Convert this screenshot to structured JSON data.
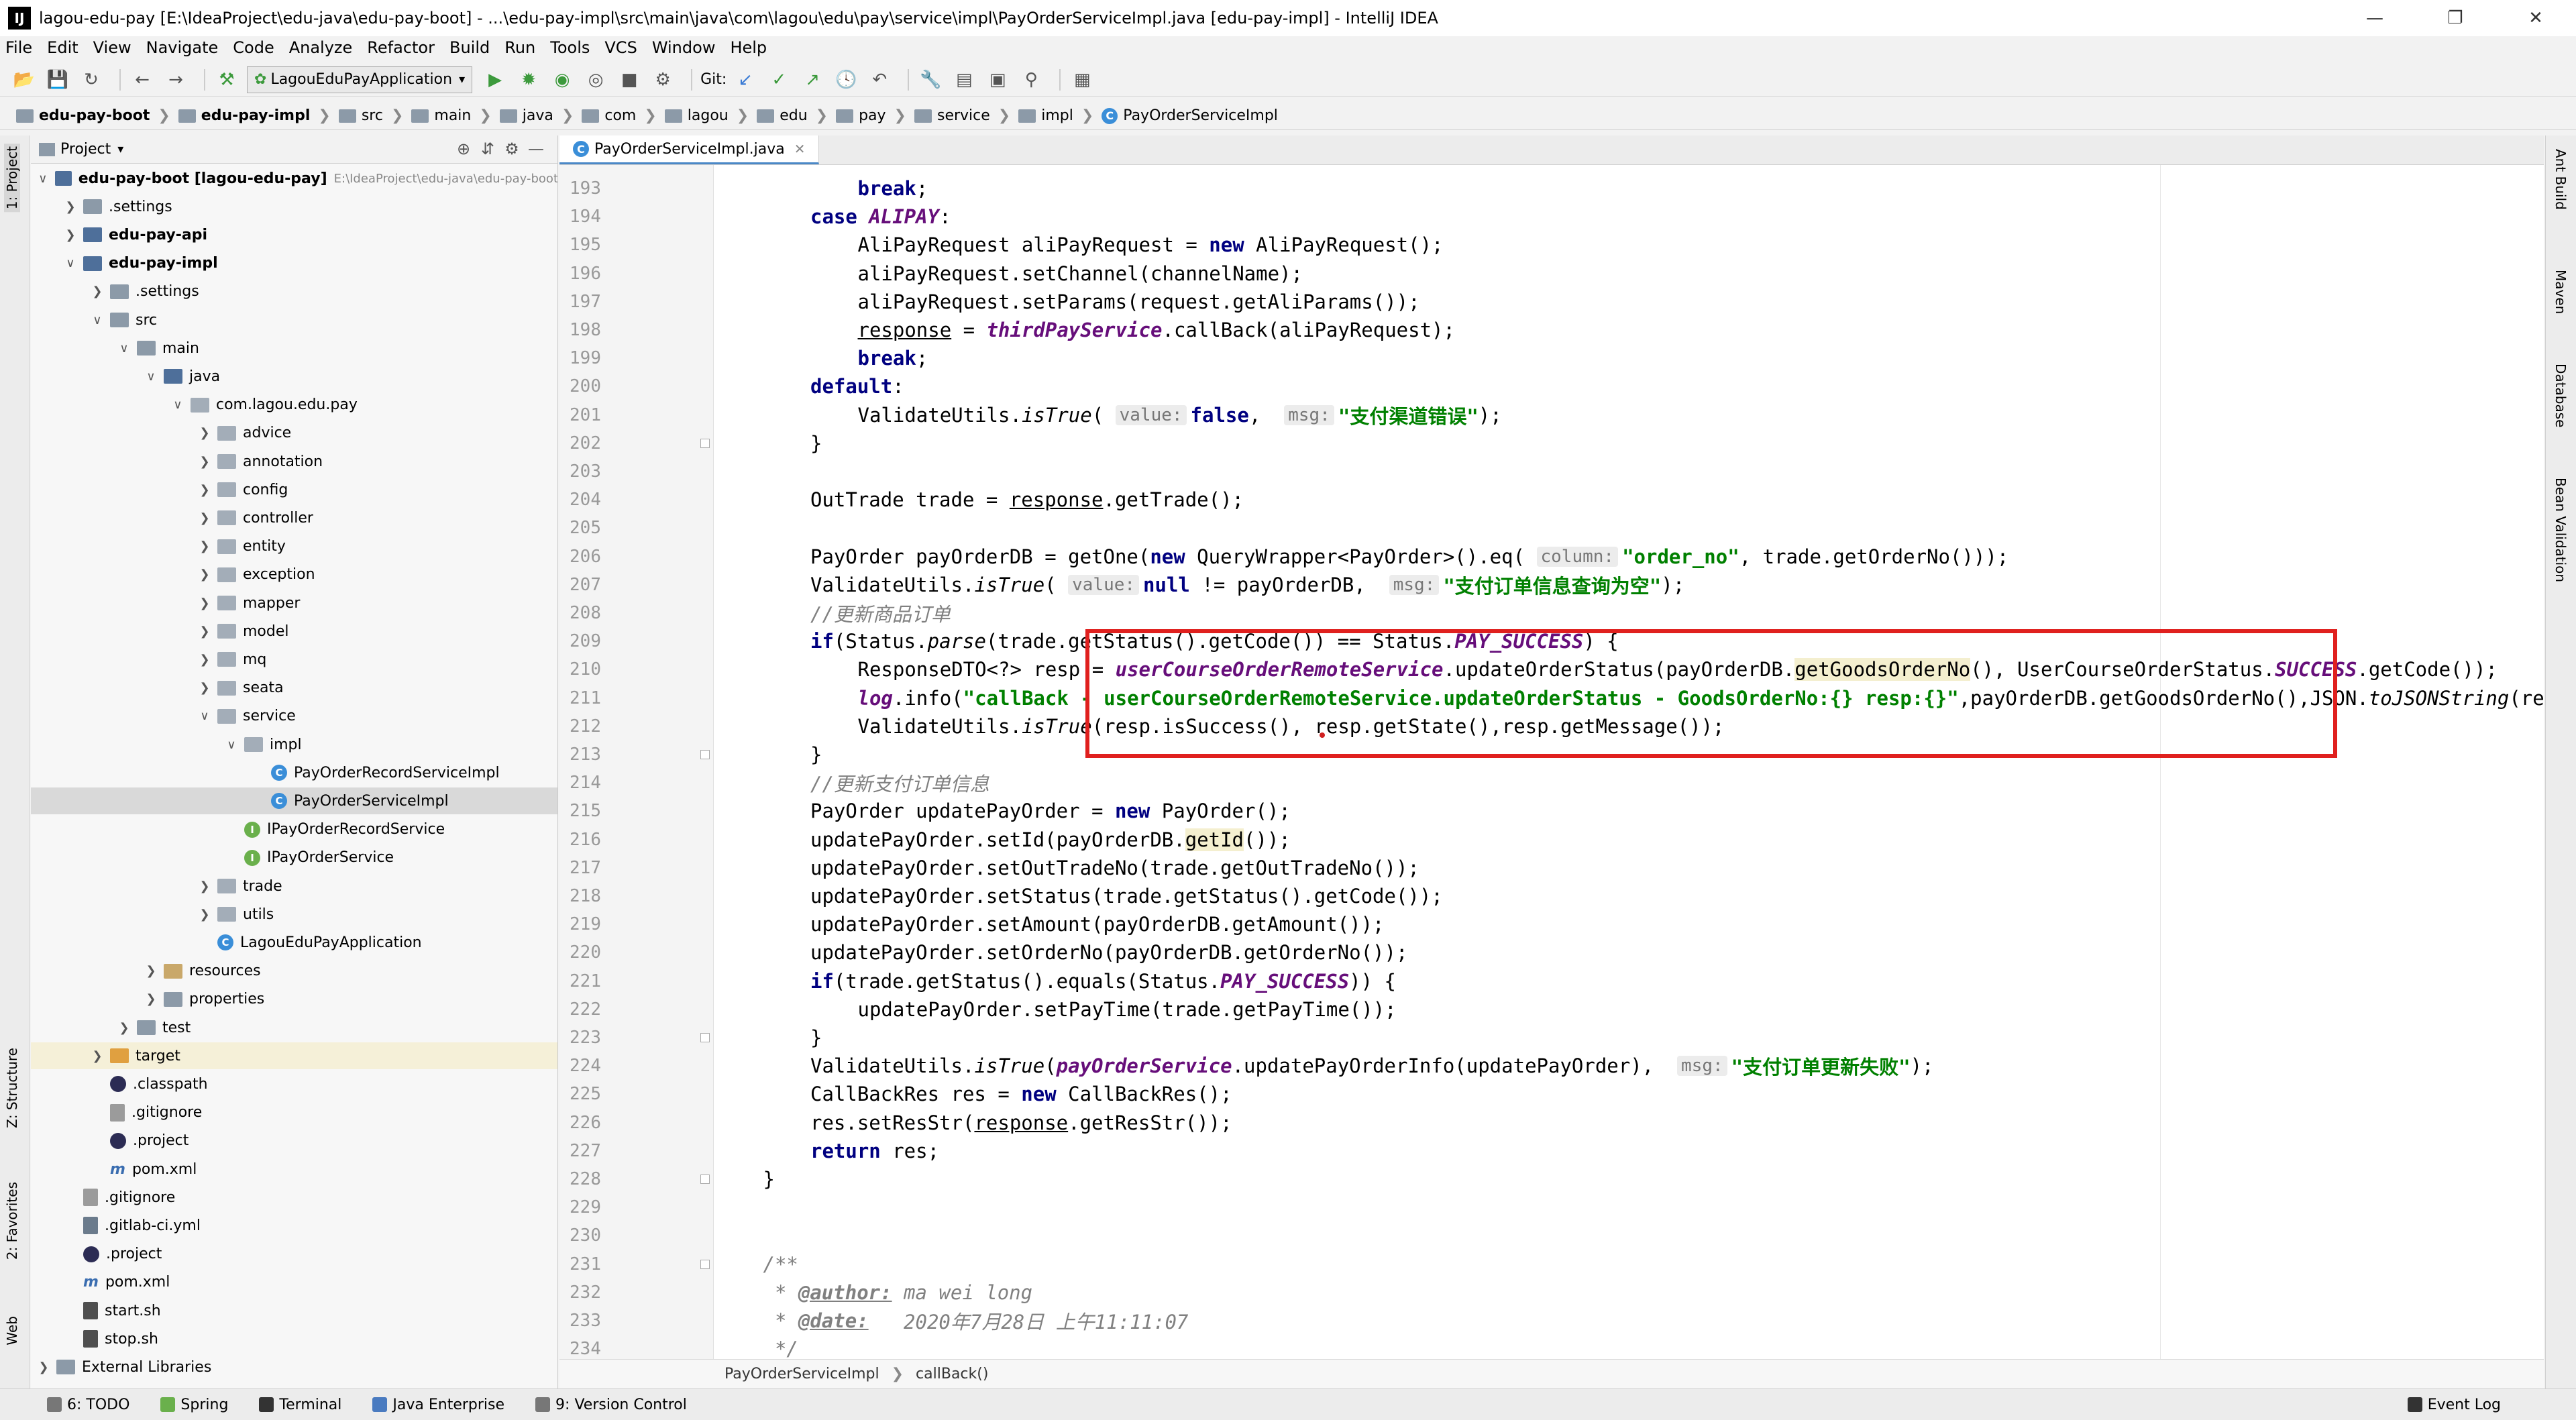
{
  "window": {
    "title": "lagou-edu-pay [E:\\IdeaProject\\edu-java\\edu-pay-boot] - ...\\edu-pay-impl\\src\\main\\java\\com\\lagou\\edu\\pay\\service\\impl\\PayOrderServiceImpl.java [edu-pay-impl] - IntelliJ IDEA",
    "logo": "IJ"
  },
  "menu": [
    "File",
    "Edit",
    "View",
    "Navigate",
    "Code",
    "Analyze",
    "Refactor",
    "Build",
    "Run",
    "Tools",
    "VCS",
    "Window",
    "Help"
  ],
  "toolbar": {
    "run_config": "LagouEduPayApplication",
    "git_label": "Git:"
  },
  "breadcrumb": [
    "edu-pay-boot",
    "edu-pay-impl",
    "src",
    "main",
    "java",
    "com",
    "lagou",
    "edu",
    "pay",
    "service",
    "impl",
    "PayOrderServiceImpl"
  ],
  "left_tool_tabs": [
    "1: Project",
    "Z: Structure",
    "2: Favorites",
    "Web"
  ],
  "right_tool_tabs": [
    "Ant Build",
    "Maven",
    "Database",
    "Bean Validation"
  ],
  "project_panel": {
    "title": "Project",
    "tree": [
      {
        "label": "edu-pay-boot [lagou-edu-pay]",
        "hint": "E:\\IdeaProject\\edu-java\\edu-pay-boot",
        "depth": 0,
        "icon": "module-folder",
        "open": true,
        "bold": true
      },
      {
        "label": ".settings",
        "depth": 1,
        "icon": "folder",
        "open": false
      },
      {
        "label": "edu-pay-api",
        "depth": 1,
        "icon": "module-folder",
        "open": false,
        "bold": true
      },
      {
        "label": "edu-pay-impl",
        "depth": 1,
        "icon": "module-folder",
        "open": true,
        "bold": true
      },
      {
        "label": ".settings",
        "depth": 2,
        "icon": "folder",
        "open": false
      },
      {
        "label": "src",
        "depth": 2,
        "icon": "folder",
        "open": true
      },
      {
        "label": "main",
        "depth": 3,
        "icon": "folder",
        "open": true
      },
      {
        "label": "java",
        "depth": 4,
        "icon": "source-folder",
        "open": true
      },
      {
        "label": "com.lagou.edu.pay",
        "depth": 5,
        "icon": "package",
        "open": true
      },
      {
        "label": "advice",
        "depth": 6,
        "icon": "package",
        "open": false
      },
      {
        "label": "annotation",
        "depth": 6,
        "icon": "package",
        "open": false
      },
      {
        "label": "config",
        "depth": 6,
        "icon": "package",
        "open": false
      },
      {
        "label": "controller",
        "depth": 6,
        "icon": "package",
        "open": false
      },
      {
        "label": "entity",
        "depth": 6,
        "icon": "package",
        "open": false
      },
      {
        "label": "exception",
        "depth": 6,
        "icon": "package",
        "open": false
      },
      {
        "label": "mapper",
        "depth": 6,
        "icon": "package",
        "open": false
      },
      {
        "label": "model",
        "depth": 6,
        "icon": "package",
        "open": false
      },
      {
        "label": "mq",
        "depth": 6,
        "icon": "package",
        "open": false
      },
      {
        "label": "seata",
        "depth": 6,
        "icon": "package",
        "open": false
      },
      {
        "label": "service",
        "depth": 6,
        "icon": "package",
        "open": true
      },
      {
        "label": "impl",
        "depth": 7,
        "icon": "package",
        "open": true
      },
      {
        "label": "PayOrderRecordServiceImpl",
        "depth": 8,
        "icon": "class"
      },
      {
        "label": "PayOrderServiceImpl",
        "depth": 8,
        "icon": "class",
        "selected": true
      },
      {
        "label": "IPayOrderRecordService",
        "depth": 7,
        "icon": "interface"
      },
      {
        "label": "IPayOrderService",
        "depth": 7,
        "icon": "interface"
      },
      {
        "label": "trade",
        "depth": 6,
        "icon": "package",
        "open": false
      },
      {
        "label": "utils",
        "depth": 6,
        "icon": "package",
        "open": false
      },
      {
        "label": "LagouEduPayApplication",
        "depth": 6,
        "icon": "app-class"
      },
      {
        "label": "resources",
        "depth": 4,
        "icon": "resources-folder",
        "open": false
      },
      {
        "label": "properties",
        "depth": 4,
        "icon": "folder",
        "open": false
      },
      {
        "label": "test",
        "depth": 3,
        "icon": "folder",
        "open": false
      },
      {
        "label": "target",
        "depth": 2,
        "icon": "target-folder",
        "open": false,
        "highlighted": true
      },
      {
        "label": ".classpath",
        "depth": 2,
        "icon": "eclipse-file"
      },
      {
        "label": ".gitignore",
        "depth": 2,
        "icon": "git-file"
      },
      {
        "label": ".project",
        "depth": 2,
        "icon": "eclipse-file"
      },
      {
        "label": "pom.xml",
        "depth": 2,
        "icon": "maven-file"
      },
      {
        "label": ".gitignore",
        "depth": 1,
        "icon": "git-file"
      },
      {
        "label": ".gitlab-ci.yml",
        "depth": 1,
        "icon": "yml-file"
      },
      {
        "label": ".project",
        "depth": 1,
        "icon": "eclipse-file"
      },
      {
        "label": "pom.xml",
        "depth": 1,
        "icon": "maven-file"
      },
      {
        "label": "start.sh",
        "depth": 1,
        "icon": "sh-file"
      },
      {
        "label": "stop.sh",
        "depth": 1,
        "icon": "sh-file"
      },
      {
        "label": "External Libraries",
        "depth": 0,
        "icon": "library",
        "open": false
      }
    ]
  },
  "editor": {
    "tab": "PayOrderServiceImpl.java",
    "breadcrumb": [
      "PayOrderServiceImpl",
      "callBack()"
    ],
    "lines": [
      {
        "n": "193",
        "indent": 5,
        "tokens": [
          [
            "kw",
            "break"
          ],
          [
            "",
            "; "
          ]
        ]
      },
      {
        "n": "194",
        "indent": 4,
        "tokens": [
          [
            "kw",
            "case "
          ],
          [
            "fld",
            "ALIPAY"
          ],
          [
            "",
            ":"
          ]
        ]
      },
      {
        "n": "195",
        "indent": 5,
        "tokens": [
          [
            "",
            "AliPayRequest aliPayRequest = "
          ],
          [
            "kw",
            "new "
          ],
          [
            "",
            "AliPayRequest();"
          ]
        ]
      },
      {
        "n": "196",
        "indent": 5,
        "tokens": [
          [
            "",
            "aliPayRequest.setChannel(channelName);"
          ]
        ]
      },
      {
        "n": "197",
        "indent": 5,
        "tokens": [
          [
            "",
            "aliPayRequest.setParams(request.getAliParams());"
          ]
        ]
      },
      {
        "n": "198",
        "indent": 5,
        "tokens": [
          [
            "ul",
            "response"
          ],
          [
            "",
            " = "
          ],
          [
            "fld",
            "thirdPayService"
          ],
          [
            "",
            ".callBack(aliPayRequest);"
          ]
        ]
      },
      {
        "n": "199",
        "indent": 5,
        "tokens": [
          [
            "kw",
            "break"
          ],
          [
            "",
            ";"
          ]
        ]
      },
      {
        "n": "200",
        "indent": 4,
        "tokens": [
          [
            "kw",
            "default"
          ],
          [
            "",
            ":"
          ]
        ]
      },
      {
        "n": "201",
        "indent": 5,
        "tokens": [
          [
            "",
            "ValidateUtils."
          ],
          [
            "stc",
            "isTrue"
          ],
          [
            "",
            "( "
          ],
          [
            "hint",
            "value:"
          ],
          [
            "kw",
            "false"
          ],
          [
            "",
            ",  "
          ],
          [
            "hint",
            "msg:"
          ],
          [
            "str",
            "\"支付渠道错误\""
          ],
          [
            "",
            ");"
          ]
        ]
      },
      {
        "n": "202",
        "indent": 4,
        "tokens": [
          [
            "",
            "}"
          ]
        ]
      },
      {
        "n": "203",
        "indent": 0,
        "tokens": []
      },
      {
        "n": "204",
        "indent": 4,
        "tokens": [
          [
            "",
            "OutTrade trade = "
          ],
          [
            "ul",
            "response"
          ],
          [
            "",
            ".getTrade();"
          ]
        ]
      },
      {
        "n": "205",
        "indent": 0,
        "tokens": []
      },
      {
        "n": "206",
        "indent": 4,
        "tokens": [
          [
            "",
            "PayOrder payOrderDB = getOne("
          ],
          [
            "kw",
            "new "
          ],
          [
            "",
            "QueryWrapper<PayOrder>().eq( "
          ],
          [
            "hint",
            "column:"
          ],
          [
            "str",
            "\"order_no\""
          ],
          [
            "",
            ", trade.getOrderNo()));"
          ]
        ]
      },
      {
        "n": "207",
        "indent": 4,
        "tokens": [
          [
            "",
            "ValidateUtils."
          ],
          [
            "stc",
            "isTrue"
          ],
          [
            "",
            "( "
          ],
          [
            "hint",
            "value:"
          ],
          [
            "kw",
            "null "
          ],
          [
            "",
            "!= payOrderDB,  "
          ],
          [
            "hint",
            "msg:"
          ],
          [
            "str",
            "\"支付订单信息查询为空\""
          ],
          [
            "",
            ");"
          ]
        ]
      },
      {
        "n": "208",
        "indent": 4,
        "tokens": [
          [
            "cmt",
            "//更新商品订单"
          ]
        ]
      },
      {
        "n": "209",
        "indent": 4,
        "tokens": [
          [
            "kw",
            "if"
          ],
          [
            "",
            "(Status."
          ],
          [
            "stc",
            "parse"
          ],
          [
            "",
            "(trade.getStatus().getCode()) == Status."
          ],
          [
            "fld",
            "PAY_SUCCESS"
          ],
          [
            "",
            ") {"
          ]
        ]
      },
      {
        "n": "210",
        "indent": 5,
        "tokens": [
          [
            "",
            "ResponseDTO<?> resp = "
          ],
          [
            "fld",
            "userCourseOrderRemoteService"
          ],
          [
            "",
            ".updateOrderStatus(payOrderDB."
          ],
          [
            "hl",
            "getGoodsOrderNo"
          ],
          [
            "",
            "(), UserCourseOrderStatus."
          ],
          [
            "fld",
            "SUCCESS"
          ],
          [
            "",
            ".getCode());"
          ]
        ]
      },
      {
        "n": "211",
        "indent": 5,
        "tokens": [
          [
            "fld",
            "log"
          ],
          [
            "",
            ".info("
          ],
          [
            "str",
            "\"callBack - userCourseOrderRemoteService.updateOrderStatus - GoodsOrderNo:{} resp:{}\""
          ],
          [
            "",
            ",payOrderDB.getGoodsOrderNo(),JSON."
          ],
          [
            "stc",
            "toJSONString"
          ],
          [
            "",
            "(resp));"
          ]
        ]
      },
      {
        "n": "212",
        "indent": 5,
        "tokens": [
          [
            "",
            "ValidateUtils."
          ],
          [
            "stc",
            "isTrue"
          ],
          [
            "",
            "(resp.isSuccess(), resp.getState(),resp.getMessage());"
          ]
        ]
      },
      {
        "n": "213",
        "indent": 4,
        "tokens": [
          [
            "",
            "}"
          ]
        ]
      },
      {
        "n": "214",
        "indent": 4,
        "tokens": [
          [
            "cmt",
            "//更新支付订单信息"
          ]
        ]
      },
      {
        "n": "215",
        "indent": 4,
        "tokens": [
          [
            "",
            "PayOrder updatePayOrder = "
          ],
          [
            "kw",
            "new "
          ],
          [
            "",
            "PayOrder();"
          ]
        ]
      },
      {
        "n": "216",
        "indent": 4,
        "tokens": [
          [
            "",
            "updatePayOrder.setId(payOrderDB."
          ],
          [
            "hl",
            "getId"
          ],
          [
            "",
            "());"
          ]
        ]
      },
      {
        "n": "217",
        "indent": 4,
        "tokens": [
          [
            "",
            "updatePayOrder.setOutTradeNo(trade.getOutTradeNo());"
          ]
        ]
      },
      {
        "n": "218",
        "indent": 4,
        "tokens": [
          [
            "",
            "updatePayOrder.setStatus(trade.getStatus().getCode());"
          ]
        ]
      },
      {
        "n": "219",
        "indent": 4,
        "tokens": [
          [
            "",
            "updatePayOrder.setAmount(payOrderDB.getAmount());"
          ]
        ]
      },
      {
        "n": "220",
        "indent": 4,
        "tokens": [
          [
            "",
            "updatePayOrder.setOrderNo(payOrderDB.getOrderNo());"
          ]
        ]
      },
      {
        "n": "221",
        "indent": 4,
        "tokens": [
          [
            "kw",
            "if"
          ],
          [
            "",
            "(trade.getStatus().equals(Status."
          ],
          [
            "fld",
            "PAY_SUCCESS"
          ],
          [
            "",
            ")) {"
          ]
        ]
      },
      {
        "n": "222",
        "indent": 5,
        "tokens": [
          [
            "",
            "updatePayOrder.setPayTime(trade.getPayTime());"
          ]
        ]
      },
      {
        "n": "223",
        "indent": 4,
        "tokens": [
          [
            "",
            "}"
          ]
        ]
      },
      {
        "n": "224",
        "indent": 4,
        "tokens": [
          [
            "",
            "ValidateUtils."
          ],
          [
            "stc",
            "isTrue"
          ],
          [
            "",
            "("
          ],
          [
            "fld",
            "payOrderService"
          ],
          [
            "",
            ".updatePayOrderInfo(updatePayOrder),  "
          ],
          [
            "hint",
            "msg:"
          ],
          [
            "str",
            "\"支付订单更新失败\""
          ],
          [
            "",
            ");"
          ]
        ]
      },
      {
        "n": "225",
        "indent": 4,
        "tokens": [
          [
            "",
            "CallBackRes res = "
          ],
          [
            "kw",
            "new "
          ],
          [
            "",
            "CallBackRes();"
          ]
        ]
      },
      {
        "n": "226",
        "indent": 4,
        "tokens": [
          [
            "",
            "res.setResStr("
          ],
          [
            "ul",
            "response"
          ],
          [
            "",
            ".getResStr());"
          ]
        ]
      },
      {
        "n": "227",
        "indent": 4,
        "tokens": [
          [
            "kw",
            "return "
          ],
          [
            "",
            "res;"
          ]
        ]
      },
      {
        "n": "228",
        "indent": 3,
        "tokens": [
          [
            "",
            "}"
          ]
        ]
      },
      {
        "n": "229",
        "indent": 0,
        "tokens": []
      },
      {
        "n": "230",
        "indent": 0,
        "tokens": []
      },
      {
        "n": "231",
        "indent": 3,
        "tokens": [
          [
            "cmt",
            "/**"
          ]
        ]
      },
      {
        "n": "232",
        "indent": 3,
        "tokens": [
          [
            "cmt",
            " * "
          ],
          [
            "tag",
            "@author:"
          ],
          [
            "cmt",
            " ma wei long"
          ]
        ]
      },
      {
        "n": "233",
        "indent": 3,
        "tokens": [
          [
            "cmt",
            " * "
          ],
          [
            "tag",
            "@date:"
          ],
          [
            "cmt",
            "   2020年7月28日 上午11:11:07"
          ]
        ]
      },
      {
        "n": "234",
        "indent": 3,
        "tokens": [
          [
            "cmt",
            " */"
          ]
        ]
      }
    ]
  },
  "statusbar": {
    "items": [
      "6: TODO",
      "Spring",
      "Terminal",
      "Java Enterprise",
      "9: Version Control"
    ],
    "right": "Event Log"
  }
}
